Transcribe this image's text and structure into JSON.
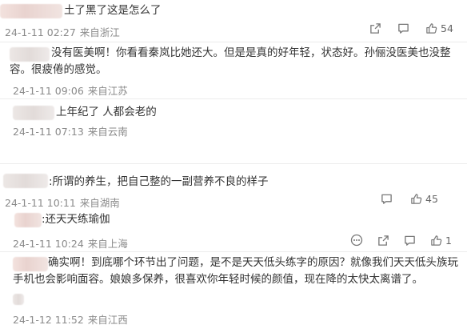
{
  "comments": [
    {
      "text": "土了黑了这是怎么了",
      "date": "24-1-11 02:27",
      "source": "来自浙江",
      "like_count": "54",
      "share_count": ""
    },
    {
      "text": "没有医美啊！你看看秦岚比她还大。但是是真的好年轻，状态好。孙俪没医美也没整容。很疲倦的感觉。",
      "date": "24-1-11 09:06",
      "source": "来自江苏"
    },
    {
      "text": "上年纪了 人都会老的",
      "date": "24-1-11 07:13",
      "source": "来自云南"
    },
    {
      "text": ":所谓的养生，把自己整的一副营养不良的样子",
      "date": "24-1-11 10:11",
      "source": "来自湖南",
      "like_count": "45"
    },
    {
      "text": ":还天天练瑜伽",
      "date": "24-1-11 10:24",
      "source": "来自上海",
      "like_count": "1"
    },
    {
      "text": "确实啊！到底哪个环节出了问题，是不是天天低头练字的原因？就像我们天天低头族玩手机也会影响面容。娘娘多保养，很喜欢你年轻时候的颜值，现在降的太快太离谱了。",
      "date": "24-1-12 11:52",
      "source": "来自江西"
    }
  ]
}
